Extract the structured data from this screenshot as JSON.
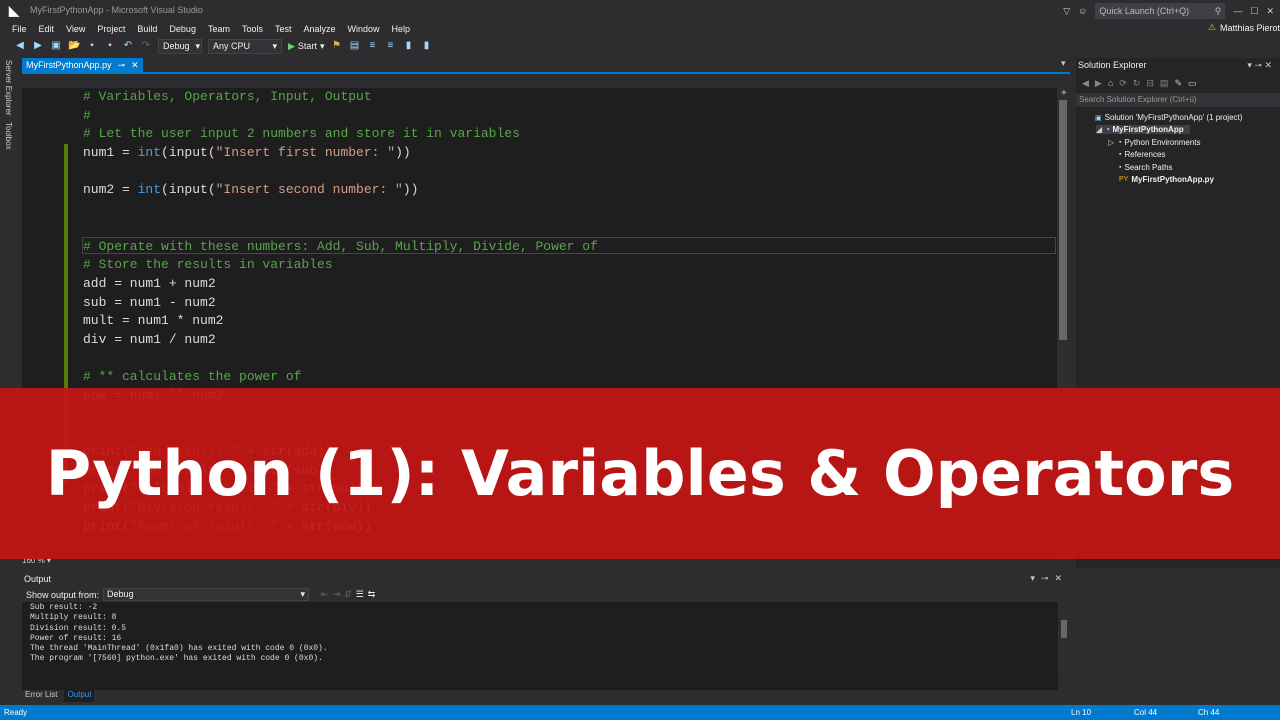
{
  "window": {
    "title": "MyFirstPythonApp - Microsoft Visual Studio",
    "quick_launch_placeholder": "Quick Launch (Ctrl+Q)",
    "user": "Matthias Pierot"
  },
  "menu": [
    "File",
    "Edit",
    "View",
    "Project",
    "Build",
    "Debug",
    "Team",
    "Tools",
    "Test",
    "Analyze",
    "Window",
    "Help"
  ],
  "toolbar": {
    "config": "Debug",
    "platform": "Any CPU",
    "start_label": "Start"
  },
  "left_rail": {
    "server_explorer": "Server Explorer",
    "toolbox": "Toolbox"
  },
  "editor": {
    "tab_label": "MyFirstPythonApp.py",
    "zoom": "160 %",
    "lines": [
      [
        {
          "t": "cmt",
          "v": "# Variables, Operators, Input, Output"
        }
      ],
      [
        {
          "t": "cmt",
          "v": "#"
        }
      ],
      [
        {
          "t": "cmt",
          "v": "# Let the user input 2 numbers and store it in variables"
        }
      ],
      [
        {
          "t": "txt",
          "v": "num1 = "
        },
        {
          "t": "kw",
          "v": "int"
        },
        {
          "t": "txt",
          "v": "(input("
        },
        {
          "t": "str",
          "v": "\"Insert first number: \""
        },
        {
          "t": "txt",
          "v": "))"
        }
      ],
      [],
      [
        {
          "t": "txt",
          "v": "num2 = "
        },
        {
          "t": "kw",
          "v": "int"
        },
        {
          "t": "txt",
          "v": "(input("
        },
        {
          "t": "str",
          "v": "\"Insert second number: \""
        },
        {
          "t": "txt",
          "v": "))"
        }
      ],
      [],
      [],
      [
        {
          "t": "cmt",
          "v": "# Operate with these numbers: Add, Sub, Multiply, Divide, Power of"
        }
      ],
      [
        {
          "t": "cmt",
          "v": "# Store the results in variables"
        }
      ],
      [
        {
          "t": "txt",
          "v": "add = num1 + num2"
        }
      ],
      [
        {
          "t": "txt",
          "v": "sub = num1 - num2"
        }
      ],
      [
        {
          "t": "txt",
          "v": "mult = num1 * num2"
        }
      ],
      [
        {
          "t": "txt",
          "v": "div = num1 / num2"
        }
      ],
      [],
      [
        {
          "t": "cmt",
          "v": "# ** calculates the power of"
        }
      ],
      [
        {
          "t": "txt",
          "v": "pow = num1 ** num2"
        }
      ],
      [],
      [],
      [
        {
          "t": "txt",
          "v": "print("
        },
        {
          "t": "str",
          "v": "\"Add result: \""
        },
        {
          "t": "txt",
          "v": " + str(add))"
        }
      ],
      [
        {
          "t": "txt",
          "v": "print("
        },
        {
          "t": "str",
          "v": "\"Sub result: \""
        },
        {
          "t": "txt",
          "v": " + str(sub))"
        }
      ],
      [
        {
          "t": "txt",
          "v": "print("
        },
        {
          "t": "str",
          "v": "\"Multiply result: \""
        },
        {
          "t": "txt",
          "v": " + str(mult))"
        }
      ],
      [
        {
          "t": "txt",
          "v": "print("
        },
        {
          "t": "str",
          "v": "\"Division result: \""
        },
        {
          "t": "txt",
          "v": " + str(div))"
        }
      ],
      [
        {
          "t": "txt",
          "v": "print("
        },
        {
          "t": "str",
          "v": "\"Power of result: \""
        },
        {
          "t": "txt",
          "v": " + str(pow))"
        }
      ]
    ]
  },
  "solution_explorer": {
    "title": "Solution Explorer",
    "search_placeholder": "Search Solution Explorer (Ctrl+ü)",
    "items": [
      {
        "label": "Solution 'MyFirstPythonApp' (1 project)",
        "indent": 0,
        "bold": false,
        "icon": "solution-icon"
      },
      {
        "label": "MyFirstPythonApp",
        "indent": 1,
        "bold": true,
        "icon": "python-project-icon",
        "selected": true
      },
      {
        "label": "Python Environments",
        "indent": 2,
        "bold": false,
        "icon": "environments-icon"
      },
      {
        "label": "References",
        "indent": 2,
        "bold": false,
        "icon": "references-icon"
      },
      {
        "label": "Search Paths",
        "indent": 2,
        "bold": false,
        "icon": "search-paths-icon"
      },
      {
        "label": "MyFirstPythonApp.py",
        "indent": 2,
        "bold": true,
        "icon": "python-file-icon"
      }
    ]
  },
  "output": {
    "title": "Output",
    "show_from_label": "Show output from:",
    "source": "Debug",
    "lines": [
      "Sub result: -2",
      "Multiply result: 8",
      "Division result: 0.5",
      "Power of result: 16",
      "The thread 'MainThread' (0x1fa0) has exited with code 0 (0x0).",
      "The program '[7560] python.exe' has exited with code 0 (0x0)."
    ],
    "tabs": [
      "Error List",
      "Output"
    ]
  },
  "status": {
    "state": "Ready",
    "ln": "Ln 10",
    "col": "Col 44",
    "ch": "Ch 44"
  },
  "banner": {
    "text": "Python (1): Variables & Operators"
  },
  "colors": {
    "accent": "#007acc",
    "banner": "#c41414",
    "comment": "#57a64a",
    "keyword": "#569cd6",
    "string": "#d69d85"
  }
}
